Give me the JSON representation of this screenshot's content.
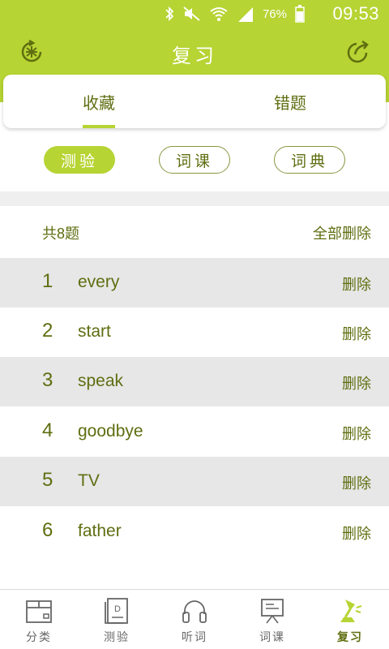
{
  "status_bar": {
    "battery": "76%",
    "time": "09:53"
  },
  "header": {
    "title": "复习"
  },
  "tabs": [
    {
      "label": "收藏",
      "active": true
    },
    {
      "label": "错题",
      "active": false
    }
  ],
  "chips": [
    {
      "label": "测验",
      "active": true
    },
    {
      "label": "词课",
      "active": false
    },
    {
      "label": "词典",
      "active": false
    }
  ],
  "summary": {
    "count": "共8题",
    "delete_all": "全部删除"
  },
  "list": [
    {
      "num": "1",
      "word": "every",
      "action": "删除"
    },
    {
      "num": "2",
      "word": "start",
      "action": "删除"
    },
    {
      "num": "3",
      "word": "speak",
      "action": "删除"
    },
    {
      "num": "4",
      "word": "goodbye",
      "action": "删除"
    },
    {
      "num": "5",
      "word": "TV",
      "action": "删除"
    },
    {
      "num": "6",
      "word": "father",
      "action": "删除"
    }
  ],
  "bottom_nav": [
    {
      "label": "分类",
      "icon": "category-box-icon"
    },
    {
      "label": "测验",
      "icon": "quiz-book-icon"
    },
    {
      "label": "听词",
      "icon": "headphones-icon"
    },
    {
      "label": "词课",
      "icon": "lesson-board-icon"
    },
    {
      "label": "复习",
      "icon": "review-lamp-icon",
      "active": true
    }
  ],
  "colors": {
    "brand": "#b6d433",
    "text": "#5f6e10",
    "row_shade": "#e7e7e7"
  }
}
